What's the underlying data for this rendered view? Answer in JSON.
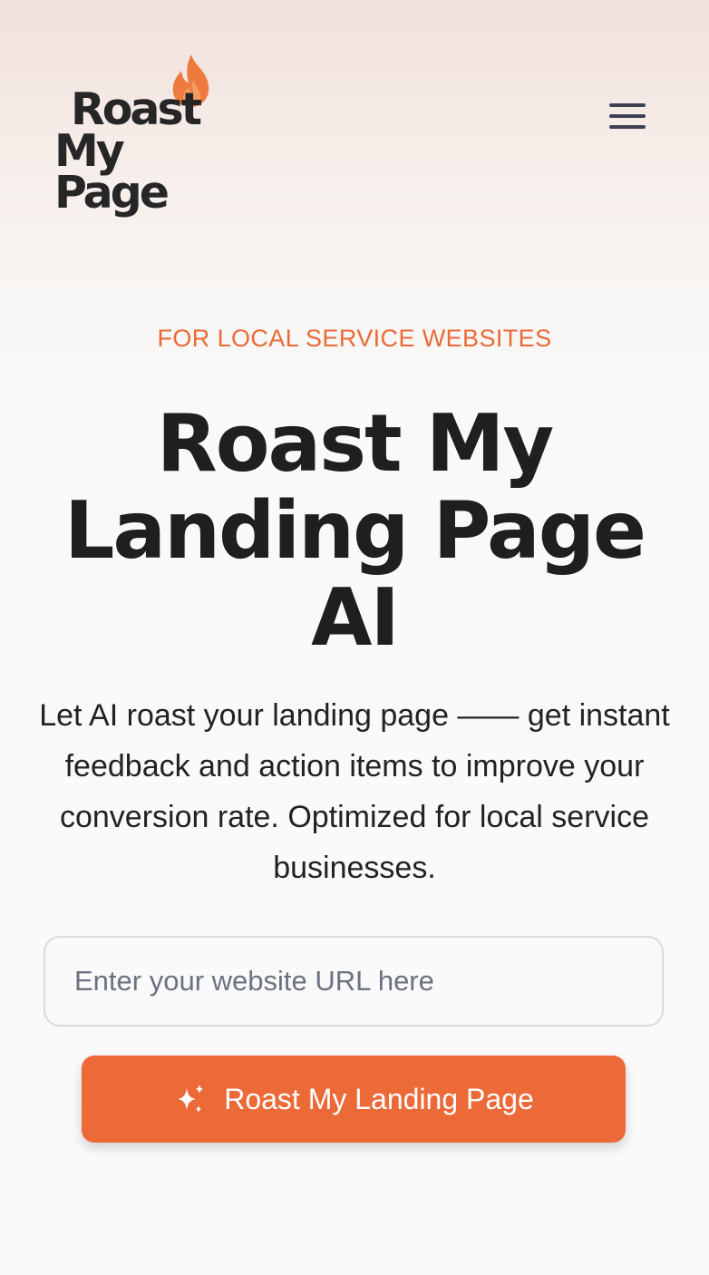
{
  "header": {
    "logo": {
      "line1": "Roast",
      "line2": "My Page",
      "flame_icon": "flame-icon",
      "flame_color": "#ef7a3e"
    },
    "menu_icon": "hamburger-menu-icon"
  },
  "hero": {
    "eyebrow": "FOR LOCAL SERVICE WEBSITES",
    "title": "Roast My Landing Page AI",
    "subtitle": "Let AI roast your landing page —— get instant feedback and action items to improve your conversion rate. Optimized for local service businesses."
  },
  "form": {
    "url_input": {
      "value": "",
      "placeholder": "Enter your website URL here"
    },
    "submit": {
      "label": "Roast My Landing Page",
      "icon": "sparkles-icon"
    }
  },
  "colors": {
    "accent": "#ec6938",
    "text": "#1f1f1f",
    "placeholder": "#6b7280",
    "menu_icon": "#3b4152"
  }
}
